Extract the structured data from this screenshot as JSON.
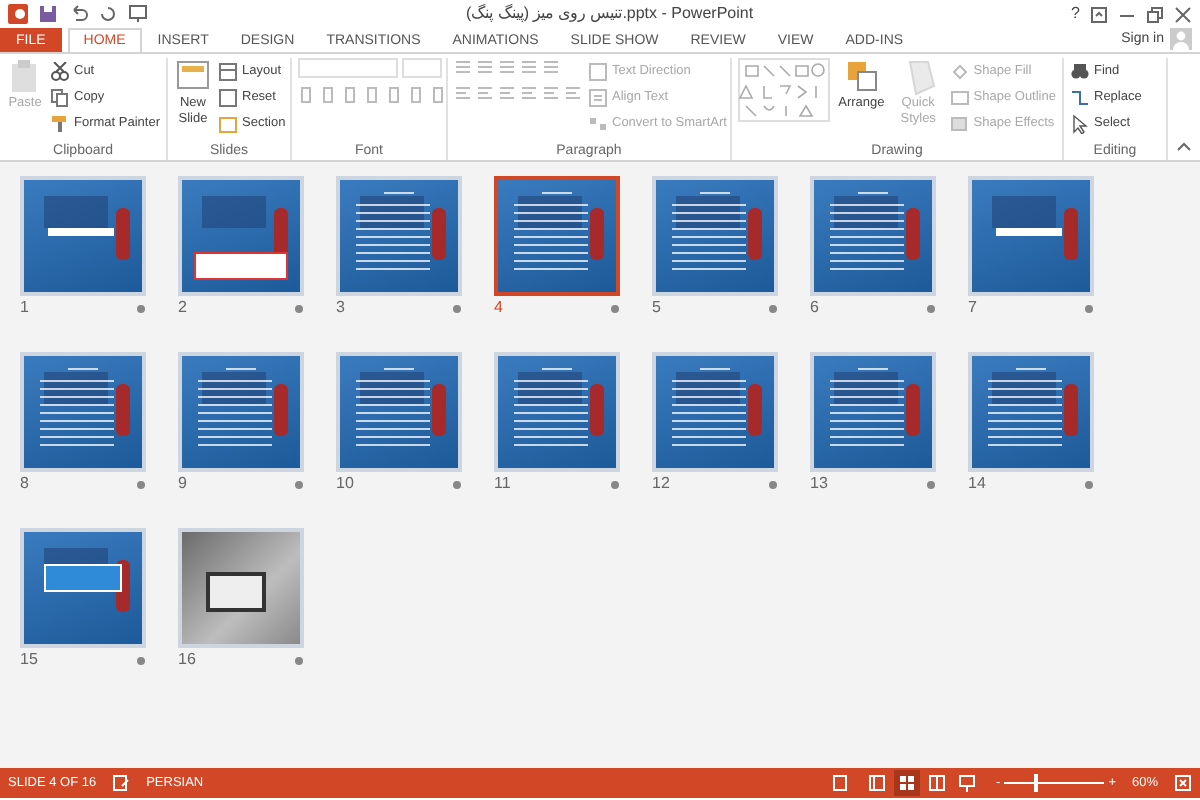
{
  "window": {
    "title": "تنیس روی میز (پینگ پنگ).pptx - PowerPoint",
    "help": "?"
  },
  "tabs": [
    {
      "label": "FILE",
      "kind": "file",
      "selected": false
    },
    {
      "label": "HOME",
      "kind": "tab",
      "selected": true
    },
    {
      "label": "INSERT",
      "kind": "tab",
      "selected": false
    },
    {
      "label": "DESIGN",
      "kind": "tab",
      "selected": false
    },
    {
      "label": "TRANSITIONS",
      "kind": "tab",
      "selected": false
    },
    {
      "label": "ANIMATIONS",
      "kind": "tab",
      "selected": false
    },
    {
      "label": "SLIDE SHOW",
      "kind": "tab",
      "selected": false
    },
    {
      "label": "REVIEW",
      "kind": "tab",
      "selected": false
    },
    {
      "label": "VIEW",
      "kind": "tab",
      "selected": false
    },
    {
      "label": "ADD-INS",
      "kind": "tab",
      "selected": false
    }
  ],
  "sign_in": "Sign in",
  "ribbon": [
    {
      "label": "Clipboard",
      "large": [
        {
          "label": "Paste",
          "disabled": true
        }
      ],
      "small": [
        {
          "label": "Cut",
          "disabled": false
        },
        {
          "label": "Copy",
          "disabled": false
        },
        {
          "label": "Format Painter",
          "disabled": false
        }
      ]
    },
    {
      "label": "Slides",
      "large": [
        {
          "label": "New Slide",
          "disabled": false
        }
      ],
      "small": [
        {
          "label": "Layout",
          "disabled": false
        },
        {
          "label": "Reset",
          "disabled": false
        },
        {
          "label": "Section",
          "disabled": false
        }
      ]
    },
    {
      "label": "Font"
    },
    {
      "label": "Paragraph",
      "small": [
        {
          "label": "Text Direction",
          "disabled": true
        },
        {
          "label": "Align Text",
          "disabled": true
        },
        {
          "label": "Convert to SmartArt",
          "disabled": true
        }
      ]
    },
    {
      "label": "Drawing",
      "large": [
        {
          "label": "Arrange",
          "disabled": false
        },
        {
          "label": "Quick Styles",
          "disabled": true
        }
      ],
      "small": [
        {
          "label": "Shape Fill",
          "disabled": true
        },
        {
          "label": "Shape Outline",
          "disabled": true
        },
        {
          "label": "Shape Effects",
          "disabled": true
        }
      ]
    },
    {
      "label": "Editing",
      "small": [
        {
          "label": "Find",
          "disabled": false
        },
        {
          "label": "Replace",
          "disabled": false
        },
        {
          "label": "Select",
          "disabled": false
        }
      ]
    }
  ],
  "slides": [
    {
      "number": "1",
      "kind": "title",
      "selected": false
    },
    {
      "number": "2",
      "kind": "caption",
      "selected": false
    },
    {
      "number": "3",
      "kind": "text",
      "selected": false
    },
    {
      "number": "4",
      "kind": "text",
      "selected": true
    },
    {
      "number": "5",
      "kind": "text",
      "selected": false
    },
    {
      "number": "6",
      "kind": "text",
      "selected": false
    },
    {
      "number": "7",
      "kind": "title",
      "selected": false
    },
    {
      "number": "8",
      "kind": "text",
      "selected": false
    },
    {
      "number": "9",
      "kind": "text",
      "selected": false
    },
    {
      "number": "10",
      "kind": "text",
      "selected": false
    },
    {
      "number": "11",
      "kind": "text",
      "selected": false
    },
    {
      "number": "12",
      "kind": "text",
      "selected": false
    },
    {
      "number": "13",
      "kind": "text",
      "selected": false
    },
    {
      "number": "14",
      "kind": "text",
      "selected": false
    },
    {
      "number": "15",
      "kind": "diagram",
      "selected": false
    },
    {
      "number": "16",
      "kind": "photo",
      "selected": false
    }
  ],
  "status_bar": {
    "slide_indicator": "SLIDE 4 OF 16",
    "language": "PERSIAN",
    "views": [
      {
        "kind": "normal",
        "selected": false
      },
      {
        "kind": "sorter",
        "selected": true
      },
      {
        "kind": "reading",
        "selected": false
      },
      {
        "kind": "slideshow",
        "selected": false
      }
    ],
    "zoom": {
      "out": "-",
      "level": 0.3,
      "in": "+",
      "reading": "60%"
    }
  }
}
